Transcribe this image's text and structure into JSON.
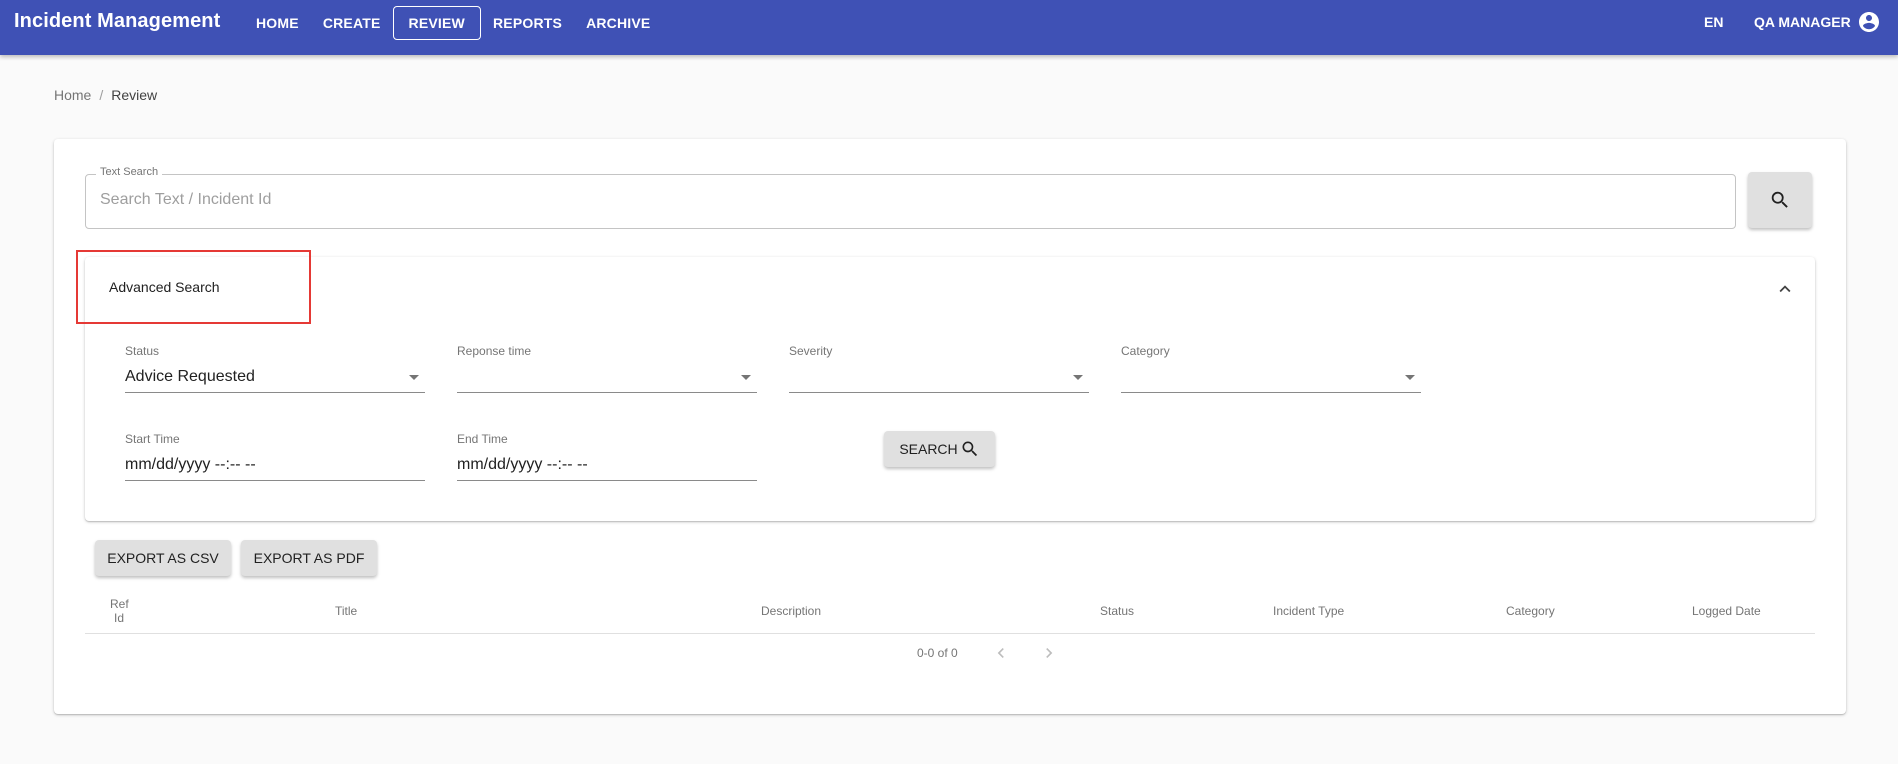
{
  "app": {
    "title": "Incident Management"
  },
  "nav": {
    "items": [
      {
        "label": "HOME"
      },
      {
        "label": "CREATE"
      },
      {
        "label": "REVIEW"
      },
      {
        "label": "REPORTS"
      },
      {
        "label": "ARCHIVE"
      }
    ],
    "active": "REVIEW",
    "language": "EN",
    "user": "QA MANAGER"
  },
  "breadcrumb": {
    "home": "Home",
    "separator": "/",
    "current": "Review"
  },
  "text_search": {
    "label": "Text Search",
    "placeholder": "Search Text / Incident Id",
    "value": ""
  },
  "advanced": {
    "title": "Advanced Search",
    "status": {
      "label": "Status",
      "value": "Advice Requested"
    },
    "response_time": {
      "label": "Reponse time",
      "value": ""
    },
    "severity": {
      "label": "Severity",
      "value": ""
    },
    "category": {
      "label": "Category",
      "value": ""
    },
    "start_time": {
      "label": "Start Time",
      "value": "mm/dd/yyyy --:-- --"
    },
    "end_time": {
      "label": "End Time",
      "value": "mm/dd/yyyy --:-- --"
    },
    "search_label": "SEARCH"
  },
  "export": {
    "csv": "EXPORT AS CSV",
    "pdf": "EXPORT AS PDF"
  },
  "table": {
    "columns": [
      "Ref",
      "Id",
      "Title",
      "Description",
      "Status",
      "Incident Type",
      "Category",
      "Logged Date"
    ],
    "rows": []
  },
  "pagination": {
    "range": "0-0 of 0"
  },
  "colors": {
    "primary": "#3f51b5",
    "highlight": "#e53935",
    "button_bg": "#e0e0e0"
  },
  "icons": [
    "account-circle-icon",
    "search-icon",
    "chevron-up-icon",
    "chevron-left-icon",
    "chevron-right-icon",
    "dropdown-arrow-icon"
  ]
}
